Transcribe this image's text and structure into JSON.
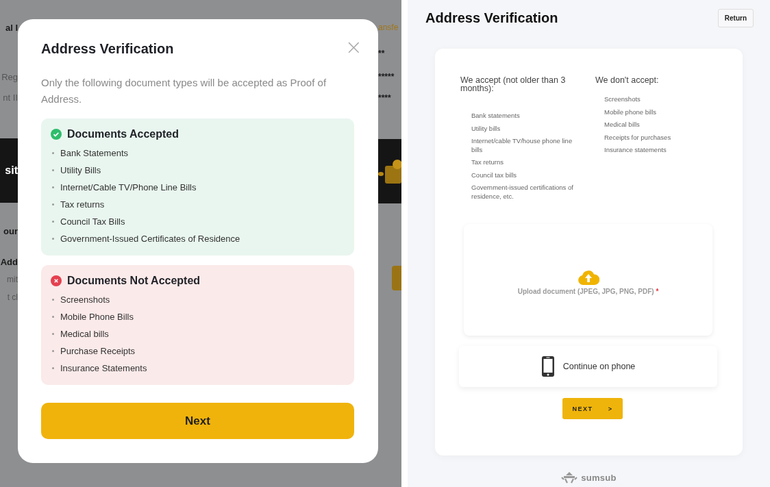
{
  "background_page": {
    "left_fragments": [
      {
        "text": "al I",
        "kind": "title"
      },
      {
        "text": "Reg",
        "kind": "label"
      },
      {
        "text": "nt II",
        "kind": "label"
      },
      {
        "text": "sit",
        "kind": "banner"
      },
      {
        "text": "our",
        "kind": "heading"
      },
      {
        "text": "Add",
        "kind": "heading"
      },
      {
        "text": "mit",
        "kind": "note"
      },
      {
        "text": "t cl",
        "kind": "note"
      }
    ],
    "right_fragments": [
      {
        "text": "ansfe",
        "kind": "link"
      },
      {
        "text": "**",
        "kind": "value"
      },
      {
        "text": "*****",
        "kind": "value"
      },
      {
        "text": "****",
        "kind": "value"
      },
      {
        "kind": "banner"
      },
      {
        "kind": "button"
      }
    ]
  },
  "modal": {
    "title": "Address Verification",
    "close": "×",
    "description": "Only the following document types will be accepted as Proof of Address.",
    "groups": [
      {
        "kind": "accepted",
        "title": "Documents Accepted",
        "items": [
          "Bank Statements",
          "Utility Bills",
          "Internet/Cable TV/Phone Line Bills",
          "Tax returns",
          "Council Tax Bills",
          "Government-Issued Certificates of Residence"
        ]
      },
      {
        "kind": "rejected",
        "title": "Documents Not Accepted",
        "items": [
          "Screenshots",
          "Mobile Phone Bills",
          "Medical bills",
          "Purchase Receipts",
          "Insurance Statements"
        ]
      }
    ],
    "button": "Next"
  },
  "verification_page": {
    "title": "Address Verification",
    "return_button": "Return",
    "columns": [
      {
        "heading": "We accept (not older than 3 months):",
        "items": [
          "Bank statements",
          "Utility bills",
          "Internet/cable TV/house phone line bills",
          "Tax returns",
          "Council tax bills",
          "Government-issued certifications of residence, etc."
        ]
      },
      {
        "heading": "We don't accept:",
        "items": [
          "Screenshots",
          "Mobile phone bills",
          "Medical bills",
          "Receipts for purchases",
          "Insurance statements"
        ]
      }
    ],
    "upload": {
      "label": "Upload document (JPEG, JPG, PNG, PDF)",
      "required_mark": "*"
    },
    "phone_option": "Continue on phone",
    "next_button": {
      "label": "NEXT",
      "arrow": ">"
    },
    "brand": "sumsub"
  }
}
